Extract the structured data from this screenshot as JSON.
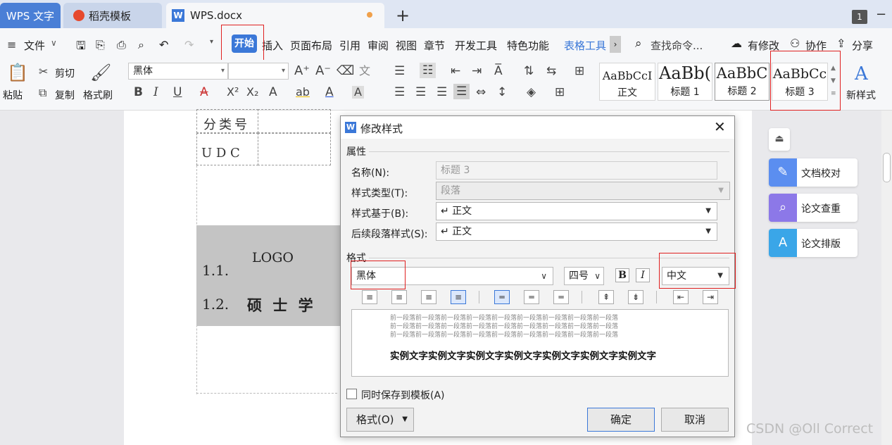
{
  "tabs": {
    "wps": "WPS 文字",
    "daoke": "稻壳模板",
    "doc": "WPS.docx",
    "new_tab": "+",
    "page_count": "1"
  },
  "menubar": {
    "file": "文件",
    "items": [
      "开始",
      "插入",
      "页面布局",
      "引用",
      "审阅",
      "视图",
      "章节",
      "开发工具",
      "特色功能"
    ],
    "table_tools": "表格工具",
    "search": "查找命令...",
    "modified": "有修改",
    "collab": "协作",
    "share": "分享"
  },
  "ribbon": {
    "paste": "粘贴",
    "cut": "剪切",
    "copy": "复制",
    "format_painter": "格式刷",
    "font_name": "黑体",
    "font_size": "",
    "styles": [
      {
        "preview": "AaBbCcI",
        "label": "正文"
      },
      {
        "preview": "AaBb(",
        "label": "标题 1"
      },
      {
        "preview": "AaBbC",
        "label": "标题 2"
      },
      {
        "preview": "AaBbCc",
        "label": "标题 3"
      }
    ],
    "new_style": "新样式"
  },
  "document": {
    "classification_label": "分类号",
    "udc_label": "U D C",
    "line1_num": "1.1.",
    "line1_text": "LOGO",
    "line2_num": "1.2.",
    "line2_text": "硕 士 学"
  },
  "side_panel": {
    "proofread": "文档校对",
    "plagiarism": "论文查重",
    "layout": "论文排版"
  },
  "dialog": {
    "title": "修改样式",
    "section_props": "属性",
    "name_label": "名称(N):",
    "name_value": "标题 3",
    "type_label": "样式类型(T):",
    "type_value": "段落",
    "based_label": "样式基于(B):",
    "based_value": "↵ 正文",
    "next_label": "后续段落样式(S):",
    "next_value": "↵ 正文",
    "section_format": "格式",
    "font_value": "黑体",
    "size_value": "四号",
    "bold": "B",
    "italic": "I",
    "script_value": "中文",
    "preview_prev": [
      "前一段落前一段落前一段落前一段落前一段落前一段落前一段落前一段落前一段落",
      "前一段落前一段落前一段落前一段落前一段落前一段落前一段落前一段落前一段落",
      "前一段落前一段落前一段落前一段落前一段落前一段落前一段落前一段落前一段落"
    ],
    "preview_sample": "实例文字实例文字实例文字实例文字实例文字实例文字实例文字",
    "save_template": "同时保存到模板(A)",
    "format_button": "格式(O)",
    "ok": "确定",
    "cancel": "取消"
  },
  "watermark": "CSDN @Oll Correct"
}
